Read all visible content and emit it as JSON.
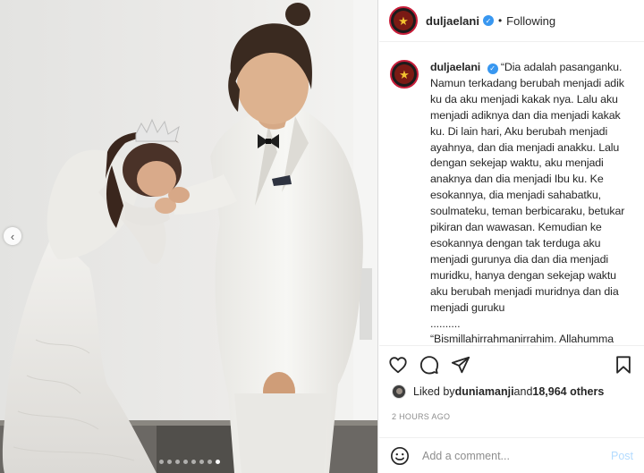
{
  "post": {
    "username": "duljaelani",
    "separator": "•",
    "follow_status": "Following",
    "avatar_icon": "star-logo-icon",
    "caption": "“Dia adalah pasanganku. Namun terkadang berubah menjadi adik ku da aku menjadi kakak nya. Lalu aku menjadi adiknya dan dia menjadi kakak ku. Di lain hari, Aku berubah menjadi ayahnya, dan dia menjadi anakku. Lalu dengan sekejap waktu, aku menjadi anaknya dan dia menjadi Ibu ku. Ke esokannya, dia menjadi sahabatku, soulmateku, teman berbicaraku, betukar pikiran dan wawasan. Kemudian ke esokannya dengan tak terduga aku menjadi gurunya dia dan dia menjadi muridku, hanya dengan sekejap waktu aku berubah menjadi muridnya dan dia menjadi guruku\n..........\n“Bismillahirrahmanirrahim. Allahumma shalli ‘ala Muhammad wa ‘ala ali",
    "liked_by_prefix": "Liked by ",
    "liked_by_user": "duniamanji",
    "liked_by_and": " and ",
    "liked_by_others": "18,964 others",
    "time_ago": "2 HOURS AGO",
    "comment_placeholder": "Add a comment...",
    "post_label": "Post"
  },
  "carousel": {
    "prev_glyph": "‹",
    "dot_count": 8,
    "active_dot": 7
  },
  "colors": {
    "verified": "#3897f0",
    "avatar_ring": "#c81e3a",
    "post_disabled": "#b3dbff"
  }
}
